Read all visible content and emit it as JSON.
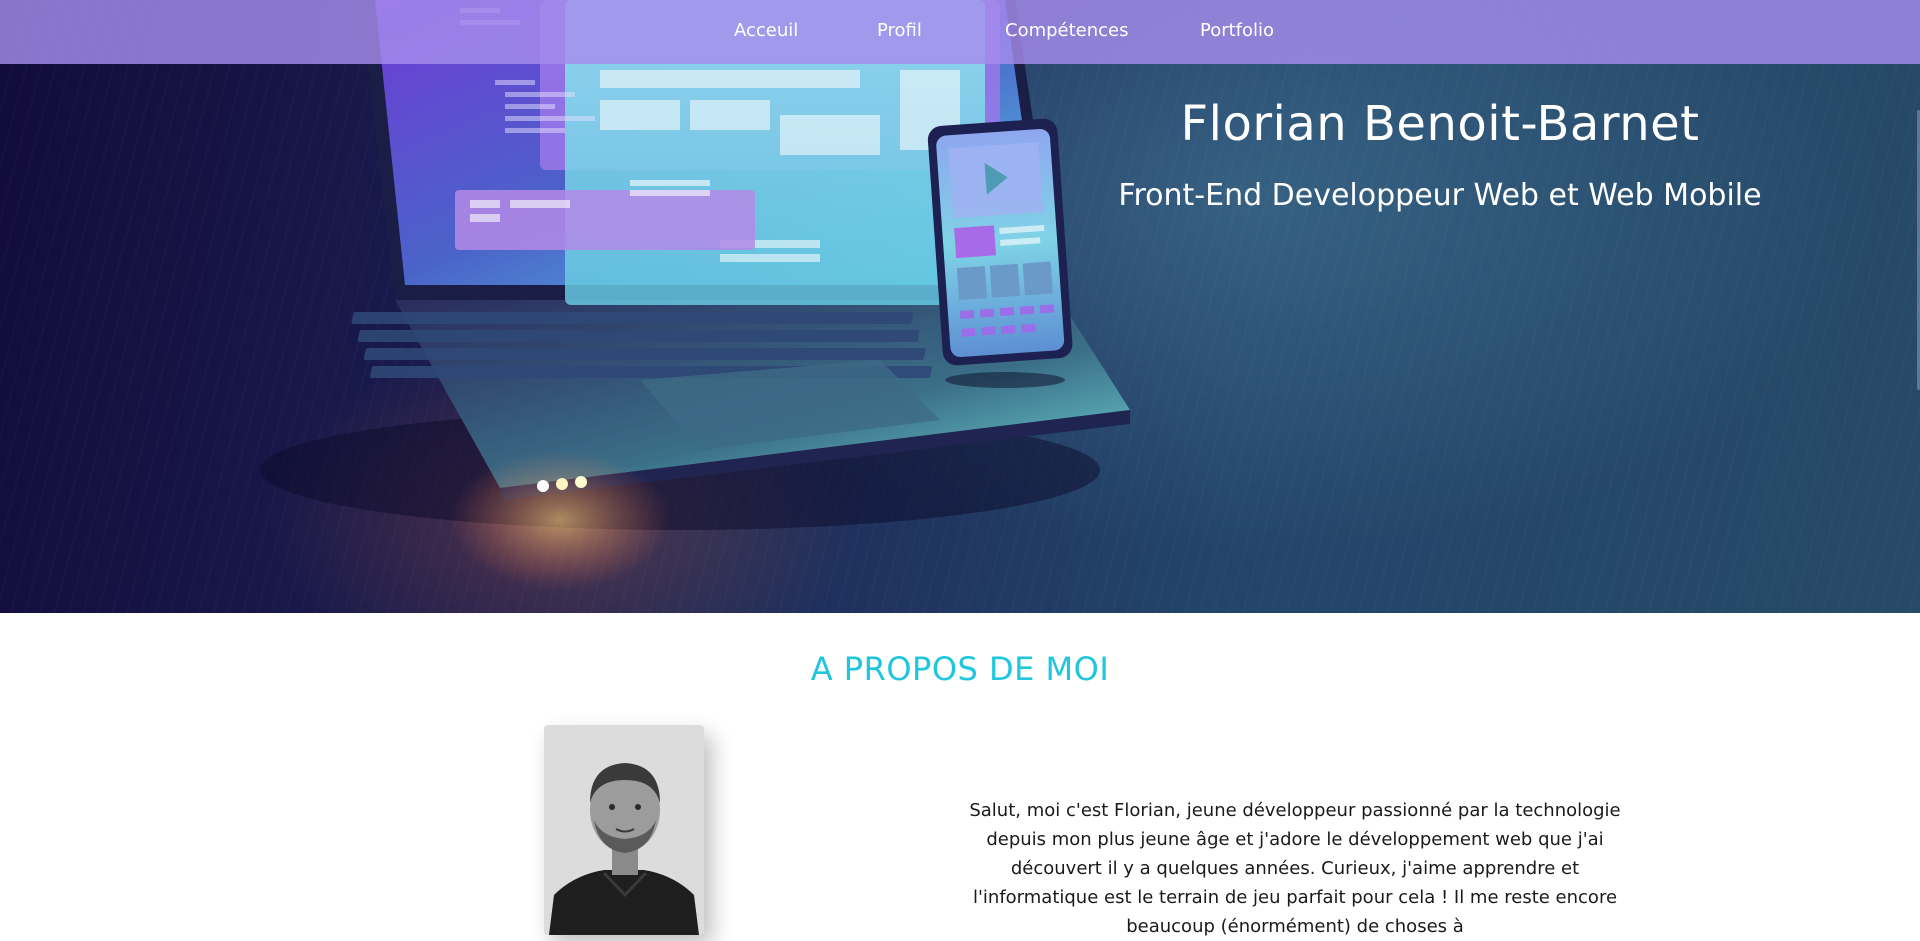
{
  "nav": {
    "items": [
      {
        "label": "Acceuil"
      },
      {
        "label": "Profil"
      },
      {
        "label": "Compétences"
      },
      {
        "label": "Portfolio"
      }
    ]
  },
  "hero": {
    "title": "Florian Benoit-Barnet",
    "subtitle": "Front-End Developpeur Web et Web Mobile",
    "illustration": "laptop-with-phone-illustration"
  },
  "about": {
    "heading": "A PROPOS DE MOI",
    "photo": "profile-photo",
    "text": "Salut, moi c'est Florian, jeune développeur passionné par la technologie depuis mon plus jeune âge et j'adore le développement web que j'ai découvert il y a quelques années. Curieux, j'aime apprendre et l'informatique est le terrain de jeu parfait pour cela ! Il me reste encore beaucoup (énormément) de choses à"
  },
  "colors": {
    "nav_bg": "#a58ceb",
    "accent": "#1fc6dd",
    "hero_dark": "#120b3a",
    "hero_teal": "#264a68"
  }
}
